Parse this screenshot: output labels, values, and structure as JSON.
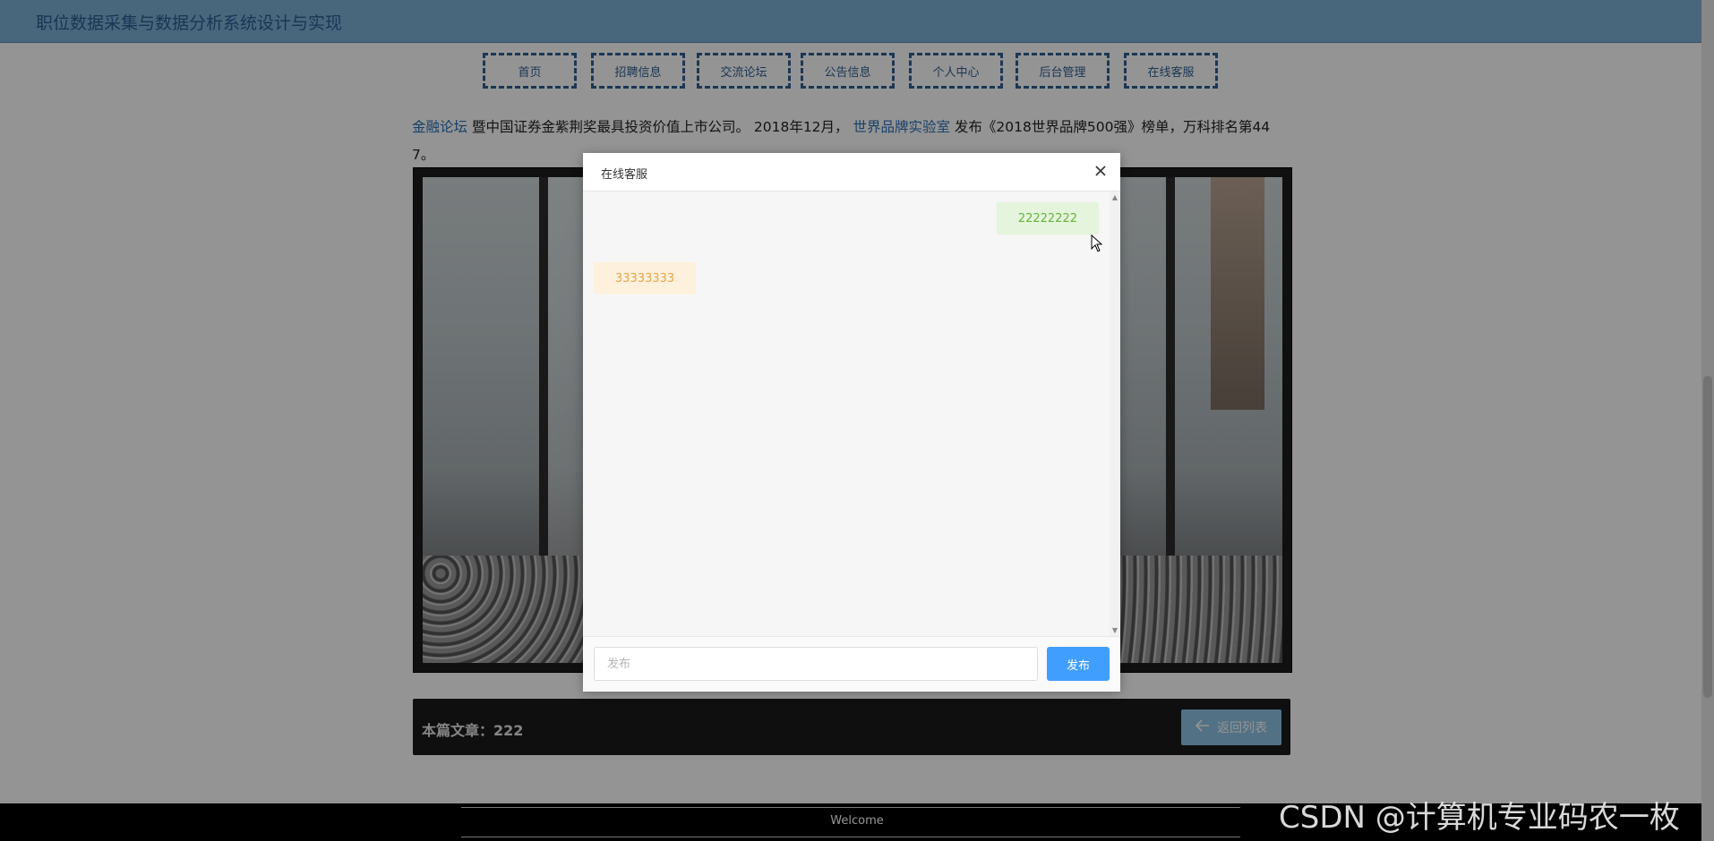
{
  "site": {
    "title": "职位数据采集与数据分析系统设计与实现"
  },
  "nav": {
    "items": [
      {
        "label": "首页"
      },
      {
        "label": "招聘信息"
      },
      {
        "label": "交流论坛"
      },
      {
        "label": "公告信息"
      },
      {
        "label": "个人中心"
      },
      {
        "label": "后台管理"
      },
      {
        "label": "在线客服"
      }
    ]
  },
  "article": {
    "line1_link_end": "金融论坛",
    "line1_text": " 暨中国证券金紫荆奖最具投资价值上市公司。 2018年12月， ",
    "line1_link2": "世界品牌实验室",
    "line1_tail": " 发布《2018世界品牌500强》榜单，万科排名第44",
    "line2": "7。",
    "count_label": "本篇文章：",
    "count_value": "222",
    "back_label": "返回列表"
  },
  "footer": {
    "welcome": "Welcome"
  },
  "dialog": {
    "title": "在线客服",
    "messages": [
      {
        "side": "right",
        "text": "22222222"
      },
      {
        "side": "left",
        "text": "33333333"
      }
    ],
    "input_placeholder": "发布",
    "send_label": "发布"
  },
  "watermark": "CSDN @计算机专业码农一枚",
  "colors": {
    "accent": "#409eff",
    "nav_border": "#2f5f91",
    "topbar": "#7fb2d6"
  }
}
